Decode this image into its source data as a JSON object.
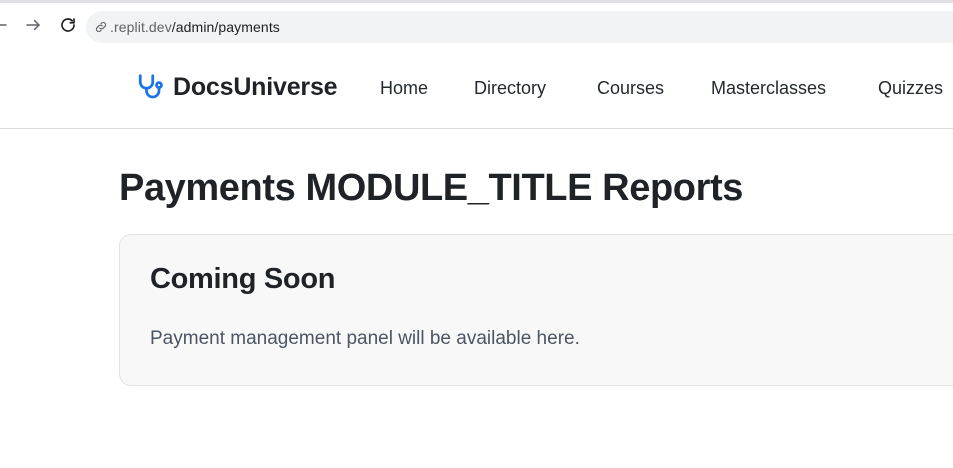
{
  "browser": {
    "url_domain": ".replit.dev",
    "url_path": "/admin/payments",
    "icons": {
      "back": "back-arrow-icon",
      "forward": "forward-arrow-icon",
      "reload": "reload-icon",
      "url": "link-icon"
    }
  },
  "header": {
    "brand_name": "DocsUniverse",
    "brand_icon": "stethoscope-icon",
    "brand_color": "#1a73e8",
    "nav": {
      "home": "Home",
      "directory": "Directory",
      "courses": "Courses",
      "masterclasses": "Masterclasses",
      "quizzes": "Quizzes"
    }
  },
  "main": {
    "title": "Payments MODULE_TITLE Reports",
    "card": {
      "title": "Coming Soon",
      "text": "Payment management panel will be available here."
    }
  }
}
